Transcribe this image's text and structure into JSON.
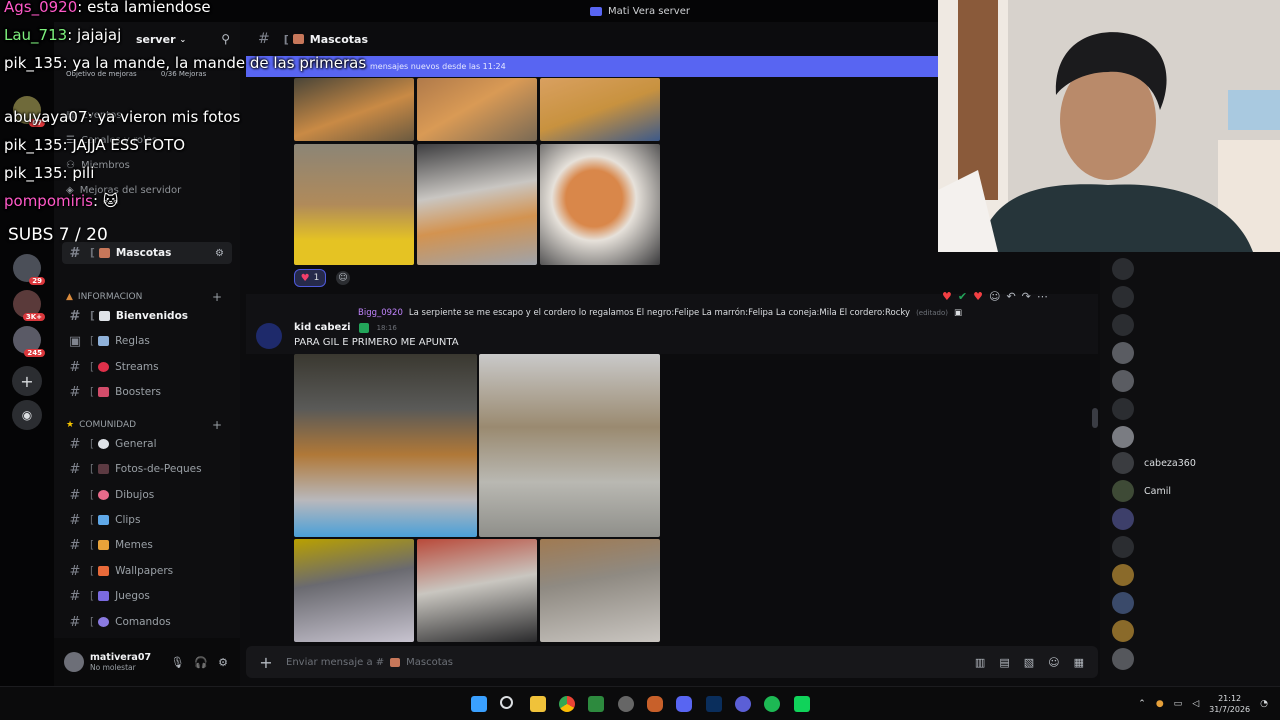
{
  "window": {
    "title": "Mati Vera server"
  },
  "server": {
    "name": "server",
    "boost_label": "Objetivo de mejoras",
    "boost_count": "0/36 Mejoras"
  },
  "sidebar": {
    "top_items": [
      "Eventos",
      "Canales y roles",
      "Miembros",
      "Mejoras del servidor"
    ],
    "active_channel": "Mascotas",
    "categories": [
      {
        "name": "INFORMACION",
        "channels": [
          "Bienvenidos",
          "Reglas",
          "Streams",
          "Boosters"
        ]
      },
      {
        "name": "COMUNIDAD",
        "channels": [
          "General",
          "Fotos-de-Peques",
          "Dibujos",
          "Clips",
          "Memes",
          "Wallpapers",
          "Juegos",
          "Comandos"
        ]
      }
    ]
  },
  "user": {
    "name": "mativera07",
    "status": "No molestar"
  },
  "channel": {
    "name": "Mascotas",
    "new_messages": "mensajes nuevos desde las 11:24"
  },
  "reaction": {
    "emoji": "heart",
    "count": "1"
  },
  "message": {
    "reply_user": "Bigg_0920",
    "reply_text": "La serpiente se me escapo y el cordero lo regalamos El negro:Felipe  La marrón:Felipa  La coneja:Mila El cordero:Rocky",
    "reply_edited": "(editado)",
    "author": "kid cabezi",
    "time": "18:16",
    "text": "PARA GIL E PRIMERO ME APUNTA"
  },
  "composer": {
    "placeholder": "Enviar mensaje a #",
    "channel": "Mascotas"
  },
  "members": [
    "cabeza360",
    "Camil"
  ],
  "taskbar": {
    "time": "21:12",
    "date": "31/7/2026"
  },
  "overlay": {
    "lines": [
      {
        "user": "Ags_0920",
        "text": "esta lamiendose"
      },
      {
        "user": "Lau_713",
        "text": "jajajaj"
      },
      {
        "user": "pik_135",
        "text": "ya la mande, la mande de las primeras"
      },
      {
        "user": "abuyaya07",
        "text": "ya vieron mis fotos"
      },
      {
        "user": "pik_135",
        "text": "JAJJA ESS FOTO"
      },
      {
        "user": "pik_135",
        "text": "pili"
      },
      {
        "user": "pompomiris",
        "text": "🐱"
      }
    ],
    "subs": "SUBS 7 / 20"
  },
  "colors": {
    "accent": "#5865f2",
    "bg": "#0c0c0e",
    "sidebar": "#0e0e10"
  }
}
